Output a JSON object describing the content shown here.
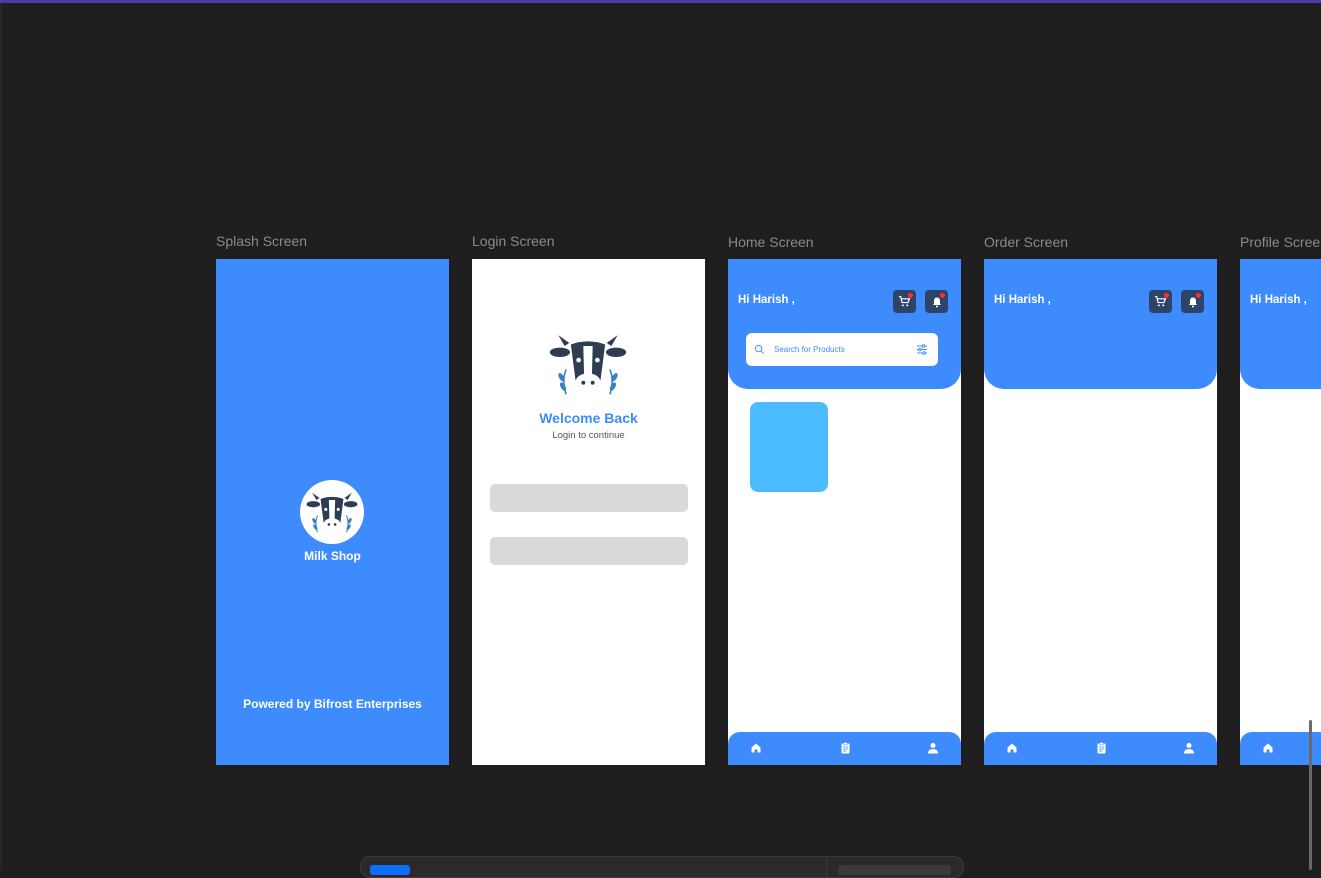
{
  "frames": {
    "splash": {
      "label": "Splash Screen",
      "app_name": "Milk Shop",
      "powered_by": "Powered by Bifrost Enterprises"
    },
    "login": {
      "label": "Login Screen",
      "title": "Welcome Back",
      "subtitle": "Login to continue"
    },
    "home": {
      "label": "Home Screen",
      "greeting": "Hi Harish ,",
      "search_placeholder": "Search for Products"
    },
    "order": {
      "label": "Order Screen",
      "greeting": "Hi Harish ,"
    },
    "profile": {
      "label": "Profile Scree",
      "greeting": "Hi Harish ,"
    }
  },
  "icons": {
    "logo": "cow-logo-icon",
    "cart": "cart-icon",
    "bell": "bell-icon",
    "search": "search-icon",
    "filter": "filter-icon",
    "nav": [
      "home-icon",
      "orders-clipboard-icon",
      "profile-icon"
    ]
  },
  "colors": {
    "primary": "#3e8bfd",
    "card": "#4abcff",
    "header_button": "#2d4468",
    "badge": "#ff2d2d",
    "canvas": "#1e1e1e",
    "input_placeholder": "#d9d9d9"
  }
}
